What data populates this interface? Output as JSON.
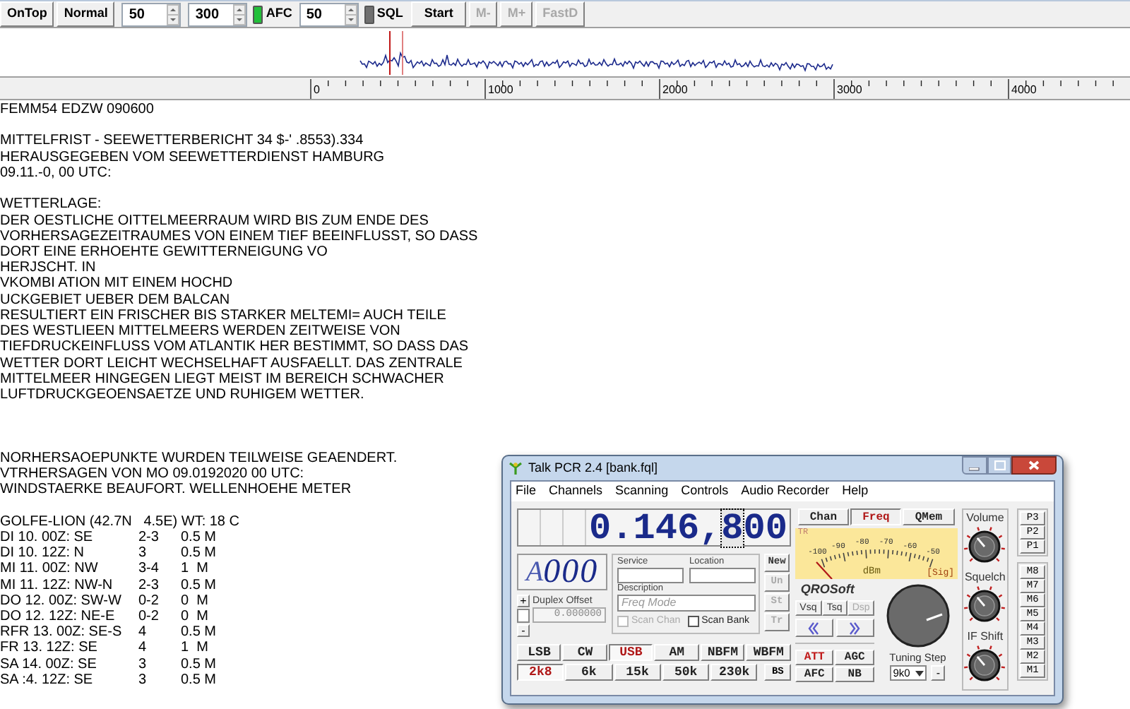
{
  "toolbar": {
    "items": [
      {
        "kind": "button",
        "label": "OnTop",
        "disabled": false
      },
      {
        "kind": "button",
        "label": "Normal",
        "disabled": false
      },
      {
        "kind": "spinner",
        "value": "50"
      },
      {
        "kind": "spinner",
        "value": "300"
      },
      {
        "kind": "indicator",
        "label": "AFC",
        "on": true
      },
      {
        "kind": "spinner",
        "value": "50"
      },
      {
        "kind": "indicator",
        "label": "SQL",
        "on": false
      },
      {
        "kind": "button",
        "label": "Start",
        "disabled": false
      },
      {
        "kind": "button",
        "label": "M-",
        "disabled": true
      },
      {
        "kind": "button",
        "label": "M+",
        "disabled": true
      },
      {
        "kind": "button",
        "label": "FastD",
        "disabled": true
      }
    ]
  },
  "ruler": {
    "labels": [
      "0",
      "1000",
      "2000",
      "3000",
      "4000"
    ]
  },
  "report": {
    "paragraphs": [
      [
        "FEMM54 EDZW 090600"
      ],
      [
        "MITTELFRIST - SEEWETTERBERICHT 34 $-' .8553).334",
        "HERAUSGEGEBEN VOM SEEWETTERDIENST HAMBURG",
        "09.11.-0, 00 UTC:"
      ],
      [
        "WETTERLAGE:",
        "DER OESTLICHE OITTELMEERRAUM WIRD BIS ZUM ENDE DES",
        "VORHERSAGEZEITRAUMES VON EINEM TIEF BEEINFLUSST, SO DASS",
        "DORT EINE ERHOEHTE GEWITTERNEIGUNG VO",
        "HERJSCHT. IN",
        "VKOMBI ATION MIT EINEM HOCHD",
        "UCKGEBIET UEBER DEM BALCAN",
        "RESULTIERT EIN FRISCHER BIS STARKER MELTEMI= AUCH TEILE",
        "DES WESTLIEEN MITTELMEERS WERDEN ZEITWEISE VON",
        "TIEFDRUCKEINFLUSS VOM ATLANTIK HER BESTIMMT, SO DASS DAS",
        "WETTER DORT LEICHT WECHSELHAFT AUSFAELLT. DAS ZENTRALE",
        "MITTELMEER HINGEGEN LIEGT MEIST IM BEREICH SCHWACHER",
        "LUFTDRUCKGEOENSAETZE UND RUHIGEM WETTER."
      ],
      [
        "NORHERSAOEPUNKTE WURDEN TEILWEISE GEAENDERT.",
        "VTRHERSAGEN VON MO 09.0192020 00 UTC:",
        "WINDSTAERKE BEAUFORT. WELLENHOEHE METER"
      ]
    ],
    "forecast": {
      "title": "GOLFE-LION (42.7N   4.5E) WT: 18 C",
      "rows": [
        {
          "time": "DI 10. 00Z: SE",
          "wind": "2-3",
          "wave": "0.5 M"
        },
        {
          "time": "DI 10. 12Z: N",
          "wind": "3",
          "wave": "0.5 M"
        },
        {
          "time": "MI 11. 00Z: NW",
          "wind": "3-4",
          "wave": "1  M"
        },
        {
          "time": "MI 11. 12Z: NW-N",
          "wind": "2-3",
          "wave": "0.5 M"
        },
        {
          "time": "DO 12. 00Z: SW-W",
          "wind": "0-2",
          "wave": "0  M"
        },
        {
          "time": "DO 12. 12Z: NE-E",
          "wind": "0-2",
          "wave": "0  M"
        },
        {
          "time": "RFR 13. 00Z: SE-S",
          "wind": "4",
          "wave": "0.5 M"
        },
        {
          "time": "FR 13. 12Z: SE",
          "wind": "4",
          "wave": "1  M"
        },
        {
          "time": "SA 14. 00Z: SE",
          "wind": "3",
          "wave": "0.5 M"
        },
        {
          "time": "SA :4. 12Z: SE",
          "wind": "3",
          "wave": "0.5 M"
        }
      ]
    }
  },
  "radio_window": {
    "title": "Talk PCR 2.4 [bank.fql]",
    "menu": [
      "File",
      "Channels",
      "Scanning",
      "Controls",
      "Audio Recorder",
      "Help"
    ],
    "frequency": [
      {
        "text": "0",
        "selected": false
      },
      {
        "text": ".",
        "selected": false
      },
      {
        "text": "1",
        "selected": false
      },
      {
        "text": "4",
        "selected": false
      },
      {
        "text": "6",
        "selected": false
      },
      {
        "text": ",",
        "selected": false
      },
      {
        "text": "8",
        "selected": true
      },
      {
        "text": "0",
        "selected": false
      },
      {
        "text": "0",
        "selected": false
      }
    ],
    "channel": {
      "bank": "A",
      "digits": "000"
    },
    "service": {
      "label": "Service"
    },
    "location": {
      "label": "Location"
    },
    "description": {
      "label": "Description",
      "placeholder": "Freq Mode"
    },
    "edit_buttons": [
      {
        "label": "New",
        "disabled": false
      },
      {
        "label": "Un",
        "disabled": true
      },
      {
        "label": "St",
        "disabled": true
      },
      {
        "label": "Tr",
        "disabled": true
      }
    ],
    "duplex": {
      "plus": "+",
      "label": "Duplex Offset",
      "value": "0.000000",
      "disabled": true,
      "checked": false,
      "minus": "-"
    },
    "scan": [
      {
        "label": "Scan Chan",
        "checked": false,
        "disabled": true
      },
      {
        "label": "Scan Bank",
        "checked": false,
        "disabled": false
      }
    ],
    "modes": [
      {
        "label": "LSB",
        "selected": false
      },
      {
        "label": "CW",
        "selected": false
      },
      {
        "label": "USB",
        "selected": true
      },
      {
        "label": "AM",
        "selected": false
      },
      {
        "label": "NBFM",
        "selected": false
      },
      {
        "label": "WBFM",
        "selected": false
      }
    ],
    "filters": [
      {
        "label": "2k8",
        "selected": true
      },
      {
        "label": "6k",
        "selected": false
      },
      {
        "label": "15k",
        "selected": false
      },
      {
        "label": "50k",
        "selected": false
      },
      {
        "label": "230k",
        "selected": false
      }
    ],
    "bs_button": "BS",
    "views": [
      {
        "label": "Chan",
        "selected": false
      },
      {
        "label": "Freq",
        "selected": true
      },
      {
        "label": "QMem",
        "selected": false
      }
    ],
    "meter": {
      "tr": "TR",
      "scale": [
        "-100",
        "-90",
        "-80",
        "-70",
        "-60",
        "-50"
      ],
      "unit": "dBm",
      "source": "[Sig]"
    },
    "brand": "QROSoft",
    "squelch_modes": [
      {
        "label": "Vsq",
        "disabled": false
      },
      {
        "label": "Tsq",
        "disabled": false
      },
      {
        "label": "Dsp",
        "disabled": true
      }
    ],
    "toggles": [
      {
        "label": "ATT",
        "on": true
      },
      {
        "label": "AGC",
        "on": false
      },
      {
        "label": "AFC",
        "on": false
      },
      {
        "label": "NB",
        "on": false
      }
    ],
    "tuning": {
      "label": "Tuning Step",
      "step": "9k0",
      "minus": "-"
    },
    "knobs": [
      {
        "label": "Volume"
      },
      {
        "label": "Squelch"
      },
      {
        "label": "IF Shift"
      }
    ],
    "presets": [
      "P3",
      "P2",
      "P1"
    ],
    "memories": [
      "M8",
      "M7",
      "M6",
      "M5",
      "M4",
      "M3",
      "M2",
      "M1"
    ]
  }
}
